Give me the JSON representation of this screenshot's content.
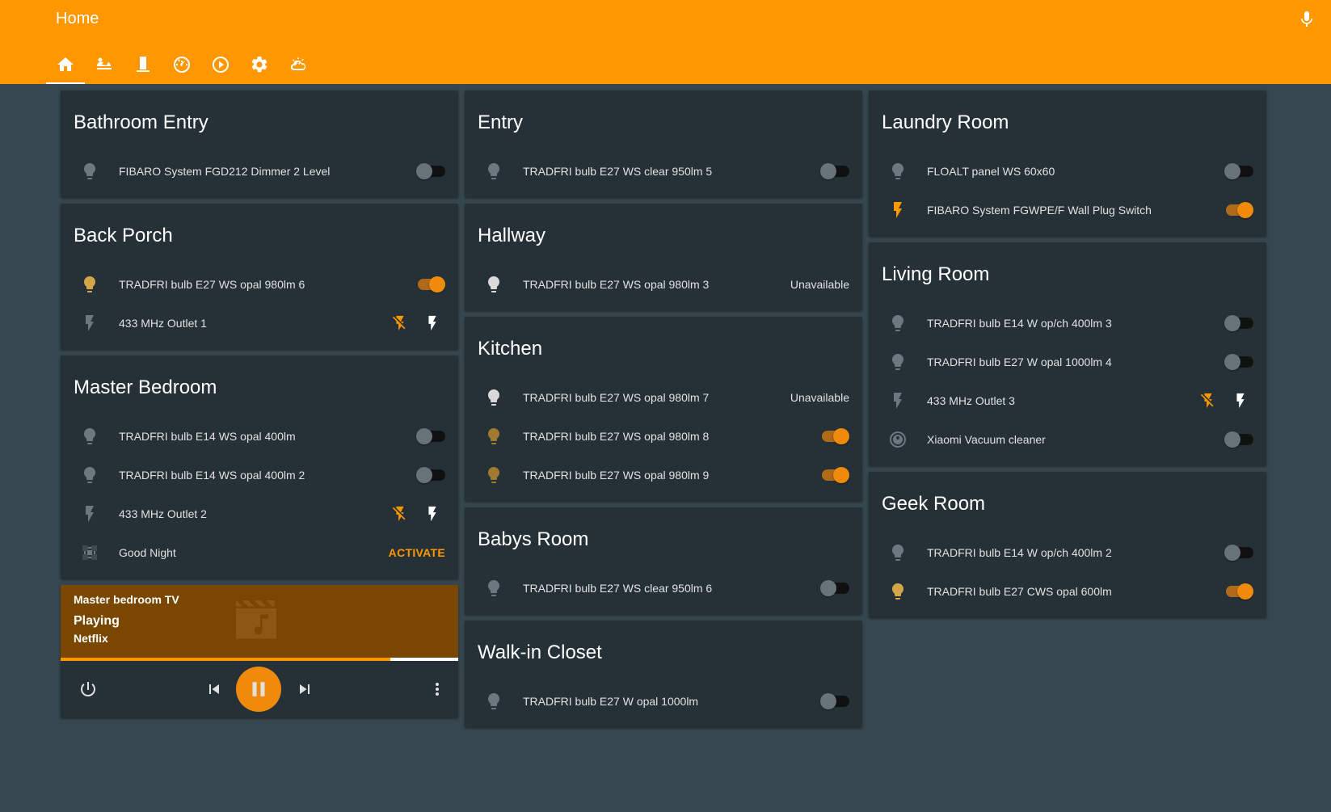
{
  "header": {
    "title": "Home",
    "tabs": [
      "home",
      "room-service",
      "entity",
      "dashboard",
      "media",
      "settings",
      "weather"
    ]
  },
  "colors": {
    "primary": "#ff9800",
    "background": "#37474f",
    "card": "#263137",
    "toggle_on": "#ef8a0b",
    "light_on": "#d4a64a"
  },
  "columns": [
    {
      "cards": [
        {
          "title": "Bathroom Entry",
          "rows": [
            {
              "icon": "bulb-icon",
              "name": "FIBARO System FGD212 Dimmer 2 Level",
              "type": "toggle",
              "on": false
            }
          ]
        },
        {
          "title": "Back Porch",
          "rows": [
            {
              "icon": "bulb-icon",
              "name": "TRADFRI bulb E27 WS opal 980lm 6",
              "type": "toggle",
              "on": true
            },
            {
              "icon": "flash-icon",
              "name": "433 MHz Outlet 1",
              "type": "outlet"
            }
          ]
        },
        {
          "title": "Master Bedroom",
          "rows": [
            {
              "icon": "bulb-icon",
              "name": "TRADFRI bulb E14 WS opal 400lm",
              "type": "toggle",
              "on": false
            },
            {
              "icon": "bulb-icon",
              "name": "TRADFRI bulb E14 WS opal 400lm 2",
              "type": "toggle",
              "on": false
            },
            {
              "icon": "flash-icon",
              "name": "433 MHz Outlet 2",
              "type": "outlet"
            },
            {
              "icon": "scene-icon",
              "name": "Good Night",
              "type": "scene",
              "action": "ACTIVATE"
            }
          ]
        }
      ],
      "media": {
        "title": "Master bedroom TV",
        "state": "Playing",
        "source": "Netflix",
        "progress": 0.83
      }
    },
    {
      "cards": [
        {
          "title": "Entry",
          "rows": [
            {
              "icon": "bulb-icon",
              "name": "TRADFRI bulb E27 WS clear 950lm 5",
              "type": "toggle",
              "on": false
            }
          ]
        },
        {
          "title": "Hallway",
          "rows": [
            {
              "icon": "bulb-icon",
              "name": "TRADFRI bulb E27 WS opal 980lm 3",
              "type": "state",
              "state": "Unavailable",
              "bright": true
            }
          ]
        },
        {
          "title": "Kitchen",
          "rows": [
            {
              "icon": "bulb-icon",
              "name": "TRADFRI bulb E27 WS opal 980lm 7",
              "type": "state",
              "state": "Unavailable",
              "bright": true
            },
            {
              "icon": "bulb-icon",
              "name": "TRADFRI bulb E27 WS opal 980lm 8",
              "type": "toggle",
              "on": true,
              "dim": true
            },
            {
              "icon": "bulb-icon",
              "name": "TRADFRI bulb E27 WS opal 980lm 9",
              "type": "toggle",
              "on": true,
              "dim": true
            }
          ]
        },
        {
          "title": "Babys Room",
          "rows": [
            {
              "icon": "bulb-icon",
              "name": "TRADFRI bulb E27 WS clear 950lm 6",
              "type": "toggle",
              "on": false
            }
          ]
        },
        {
          "title": "Walk-in Closet",
          "rows": [
            {
              "icon": "bulb-icon",
              "name": "TRADFRI bulb E27 W opal 1000lm",
              "type": "toggle",
              "on": false
            }
          ]
        }
      ]
    },
    {
      "cards": [
        {
          "title": "Laundry Room",
          "rows": [
            {
              "icon": "bulb-icon",
              "name": "FLOALT panel WS 60x60",
              "type": "toggle",
              "on": false
            },
            {
              "icon": "flash-icon",
              "name": "FIBARO System FGWPE/F Wall Plug Switch",
              "type": "toggle",
              "on": true
            }
          ]
        },
        {
          "title": "Living Room",
          "rows": [
            {
              "icon": "bulb-icon",
              "name": "TRADFRI bulb E14 W op/ch 400lm 3",
              "type": "toggle",
              "on": false
            },
            {
              "icon": "bulb-icon",
              "name": "TRADFRI bulb E27 W opal 1000lm 4",
              "type": "toggle",
              "on": false
            },
            {
              "icon": "flash-icon",
              "name": "433 MHz Outlet 3",
              "type": "outlet"
            },
            {
              "icon": "robot-vacuum-icon",
              "name": "Xiaomi Vacuum cleaner",
              "type": "toggle",
              "on": false
            }
          ]
        },
        {
          "title": "Geek Room",
          "rows": [
            {
              "icon": "bulb-icon",
              "name": "TRADFRI bulb E14 W op/ch 400lm 2",
              "type": "toggle",
              "on": false
            },
            {
              "icon": "bulb-icon",
              "name": "TRADFRI bulb E27 CWS opal 600lm",
              "type": "toggle",
              "on": true
            }
          ]
        }
      ]
    }
  ]
}
